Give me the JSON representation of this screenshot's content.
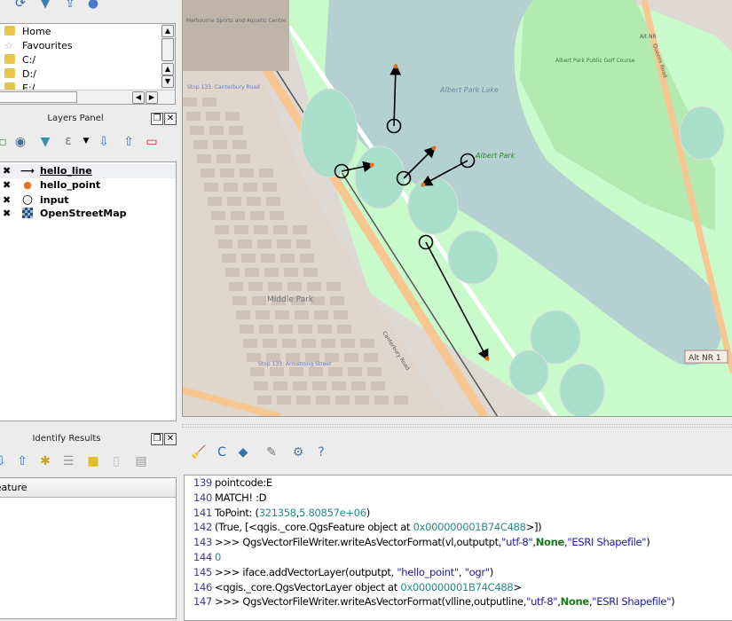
{
  "browser": {
    "items": [
      {
        "label": "Home",
        "icon": "folder-icon"
      },
      {
        "label": "Favourites",
        "icon": "star-icon"
      },
      {
        "label": "C:/",
        "icon": "folder-icon"
      },
      {
        "label": "D:/",
        "icon": "folder-icon"
      },
      {
        "label": "E:/",
        "icon": "folder-icon"
      }
    ]
  },
  "layers_panel": {
    "title": "Layers Panel",
    "layers": [
      {
        "name": "hello_line",
        "visible": true,
        "symbol": "line-arrow"
      },
      {
        "name": "hello_point",
        "visible": true,
        "symbol": "orange-dot"
      },
      {
        "name": "input",
        "visible": true,
        "symbol": "circle"
      },
      {
        "name": "OpenStreetMap",
        "visible": true,
        "symbol": "raster"
      }
    ]
  },
  "identify": {
    "title": "Identify Results",
    "column": "Feature"
  },
  "map": {
    "labels": {
      "lake": "Albert Park Lake",
      "park": "Albert Park",
      "suburb": "Middle Park",
      "golf": "Albert Park Public Golf Course",
      "road1": "Canterbury Road",
      "road2": "Queens Road",
      "aquatic": "Melbourne Sports and Aquatic Centre",
      "stop1": "Stop 133: Armstrong Street",
      "stop2": "Stop 133: Canterbury Road",
      "a1": "Alt NR",
      "a2": "Alt NR 1"
    }
  },
  "console": {
    "lines": [
      {
        "n": "139",
        "parts": [
          {
            "t": "pointcode:E",
            "c": ""
          }
        ]
      },
      {
        "n": "140",
        "parts": [
          {
            "t": "MATCH! :D",
            "c": ""
          }
        ]
      },
      {
        "n": "141",
        "parts": [
          {
            "t": "ToPoint: (",
            "c": ""
          },
          {
            "t": "321358",
            "c": "num"
          },
          {
            "t": ",",
            "c": ""
          },
          {
            "t": "5.80857e+06",
            "c": "num"
          },
          {
            "t": ")",
            "c": ""
          }
        ]
      },
      {
        "n": "142",
        "parts": [
          {
            "t": "(True, [<qgis._core.QgsFeature object at ",
            "c": ""
          },
          {
            "t": "0x000000001B74C488",
            "c": "num"
          },
          {
            "t": ">])",
            "c": ""
          }
        ]
      },
      {
        "n": "143",
        "parts": [
          {
            "t": ">>> QgsVectorFileWriter.writeAsVectorFormat(vl,outputpt,",
            "c": ""
          },
          {
            "t": "\"utf-8\"",
            "c": "str"
          },
          {
            "t": ",",
            "c": ""
          },
          {
            "t": "None",
            "c": "kw"
          },
          {
            "t": ",",
            "c": ""
          },
          {
            "t": "\"ESRI Shapefile\"",
            "c": "str"
          },
          {
            "t": ")",
            "c": ""
          }
        ]
      },
      {
        "n": "144",
        "parts": [
          {
            "t": "0",
            "c": "num"
          }
        ]
      },
      {
        "n": "145",
        "parts": [
          {
            "t": ">>> iface.addVectorLayer(outputpt, ",
            "c": ""
          },
          {
            "t": "\"hello_point\"",
            "c": "str"
          },
          {
            "t": ", ",
            "c": ""
          },
          {
            "t": "\"ogr\"",
            "c": "str"
          },
          {
            "t": ")",
            "c": ""
          }
        ]
      },
      {
        "n": "146",
        "parts": [
          {
            "t": "<qgis._core.QgsVectorLayer object at ",
            "c": ""
          },
          {
            "t": "0x000000001B74C488",
            "c": "num"
          },
          {
            "t": ">",
            "c": ""
          }
        ]
      },
      {
        "n": "147",
        "parts": [
          {
            "t": ">>> QgsVectorFileWriter.writeAsVectorFormat(vlline,outputline,",
            "c": ""
          },
          {
            "t": "\"utf-8\"",
            "c": "str"
          },
          {
            "t": ",",
            "c": ""
          },
          {
            "t": "None",
            "c": "kw"
          },
          {
            "t": ",",
            "c": ""
          },
          {
            "t": "\"ESRI Shapefile\"",
            "c": "str"
          },
          {
            "t": ")",
            "c": ""
          }
        ]
      }
    ]
  },
  "colors": {
    "water": "#b5d0d0",
    "park": "#c8facc",
    "pitch": "#aae0cb",
    "road": "#f8c690",
    "residential": "#ded9d3",
    "building": "#c9b9ad",
    "accent_point": "#e8701a"
  }
}
